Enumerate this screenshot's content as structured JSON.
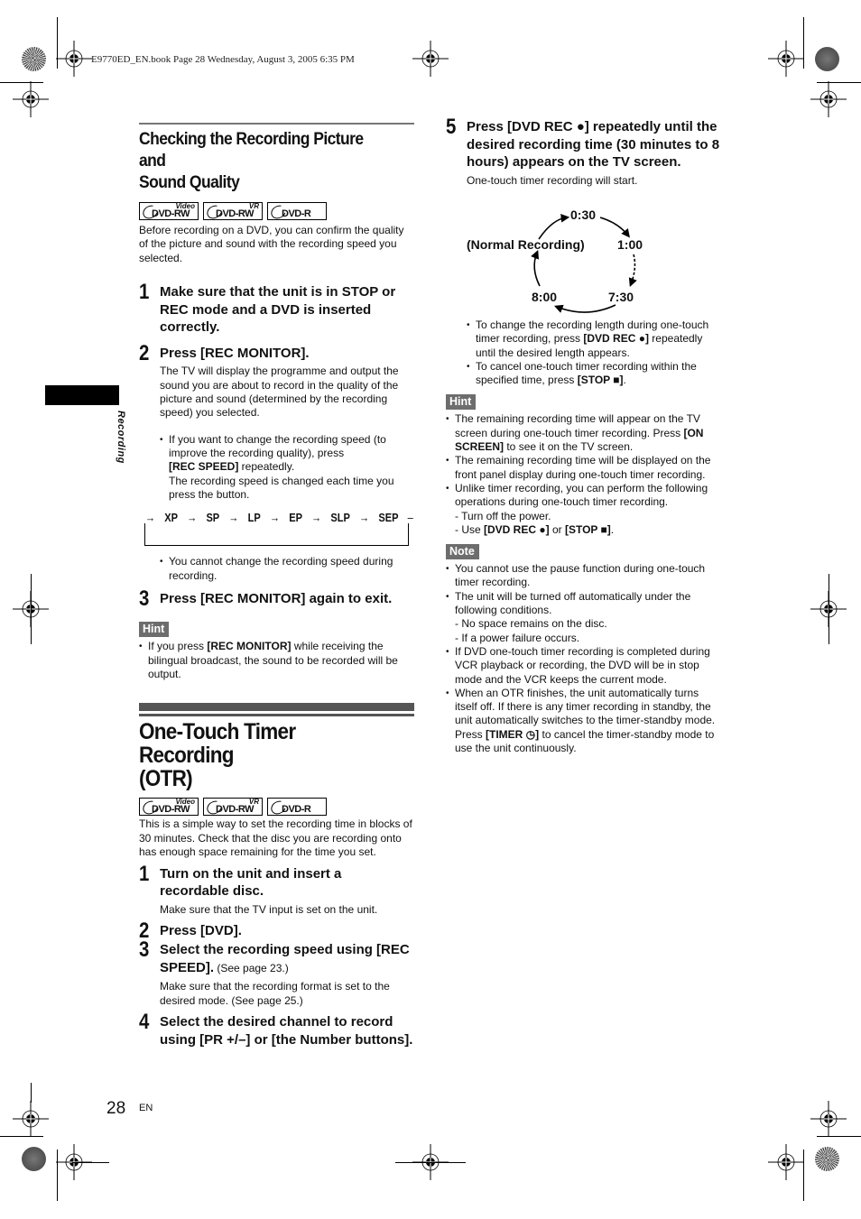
{
  "print_header": "E9770ED_EN.book  Page 28  Wednesday, August 3, 2005  6:35 PM",
  "sidebar": {
    "section_label": "Recording"
  },
  "footer": {
    "page_number": "28",
    "language": "EN"
  },
  "disc_logos": [
    {
      "name": "DVD-RW",
      "sup": "Video"
    },
    {
      "name": "DVD-RW",
      "sup": "VR"
    },
    {
      "name": "DVD-R",
      "sup": ""
    }
  ],
  "check_section": {
    "title_line1": "Checking the Recording Picture and",
    "title_line2": "Sound Quality",
    "intro": "Before recording on a DVD, you can confirm the quality of the picture and sound with the recording speed you selected.",
    "steps": [
      {
        "num": "1",
        "title": "Make sure that the unit is in STOP or REC mode and a DVD is inserted correctly."
      },
      {
        "num": "2",
        "title": "Press [REC MONITOR].",
        "sub": "The TV will display the programme and output the sound you are about to record in the quality of the picture and sound (determined by the recording speed) you selected."
      },
      {
        "num": "3",
        "title": "Press [REC MONITOR] again to exit."
      }
    ],
    "bullet_speed_a": "If you want to change the recording speed (to improve the recording quality), press",
    "bullet_speed_key": "[REC SPEED]",
    "bullet_speed_b": " repeatedly.",
    "bullet_speed_c": "The recording speed is changed each time you press the button.",
    "speed_cycle": [
      "XP",
      "SP",
      "LP",
      "EP",
      "SLP",
      "SEP"
    ],
    "arrow": "→",
    "bullet_no_change": "You cannot change the recording speed during recording.",
    "hint_label": "Hint",
    "hint_a": "If you press ",
    "hint_key": "[REC MONITOR]",
    "hint_b": " while receiving the bilingual broadcast, the sound to be recorded will be output."
  },
  "otr_section": {
    "title_line1": "One-Touch Timer Recording",
    "title_line2": "(OTR)",
    "intro": "This is a simple way to set the recording time in blocks of 30 minutes. Check that the disc you are recording onto has enough space remaining for the time you set.",
    "step1_title": "Turn on the unit and insert a recordable disc.",
    "step1_sub": "Make sure that the TV input is set on the unit.",
    "step2_title": "Press [DVD].",
    "step3_title": "Select the recording speed using [REC SPEED].",
    "step3_see": " (See page 23.)",
    "step3_sub": "Make sure that the recording format is set to the desired mode. (See page 25.)",
    "step4_title": "Select the desired channel to record using [PR +/–] or [the Number buttons].",
    "step5_title": "Press [DVD REC ●] repeatedly until the desired recording time (30 minutes to 8 hours) appears on the TV screen.",
    "step5_sub": "One-touch timer recording will start.",
    "cycle": {
      "top": "0:30",
      "left": "(Normal Recording)",
      "right": "1:00",
      "bottom_right": "7:30",
      "bottom_left": "8:00"
    },
    "bullet_change_a": "To change the recording length during one-touch timer recording, press ",
    "bullet_change_key": "[DVD REC ●]",
    "bullet_change_b": " repeatedly until the desired length appears.",
    "bullet_cancel_a": "To cancel one-touch timer recording within the specified time, press ",
    "bullet_cancel_key": "[STOP ■]",
    "bullet_cancel_b": ".",
    "hint_label": "Hint",
    "hint1_a": "The remaining recording time will appear on the TV screen during one-touch timer recording. Press ",
    "hint1_key": "[ON SCREEN]",
    "hint1_b": " to see it on the TV screen.",
    "hint2": "The remaining recording time will be displayed on the front panel display during one-touch timer recording.",
    "hint3": "Unlike timer recording, you can perform the following operations during one-touch timer recording.",
    "hint3_d1": "- Turn off the power.",
    "hint3_d2_a": "- Use ",
    "hint3_d2_k1": "[DVD REC ●]",
    "hint3_d2_b": " or ",
    "hint3_d2_k2": "[STOP ■]",
    "hint3_d2_c": ".",
    "note_label": "Note",
    "note1": "You cannot use the pause function during one-touch timer recording.",
    "note2": "The unit will be turned off automatically under the following conditions.",
    "note2_d1": "- No space remains on the disc.",
    "note2_d2": "- If a power failure occurs.",
    "note3": "If DVD one-touch timer recording is completed during VCR playback or recording, the DVD will be in stop mode and the VCR keeps the current mode.",
    "note4_a": "When an OTR finishes, the unit automatically turns itself off. If there is any timer recording in standby, the unit automatically switches to the timer-standby mode. Press ",
    "note4_key": "[TIMER ◷]",
    "note4_b": " to cancel the timer-standby mode to use the unit continuously."
  }
}
